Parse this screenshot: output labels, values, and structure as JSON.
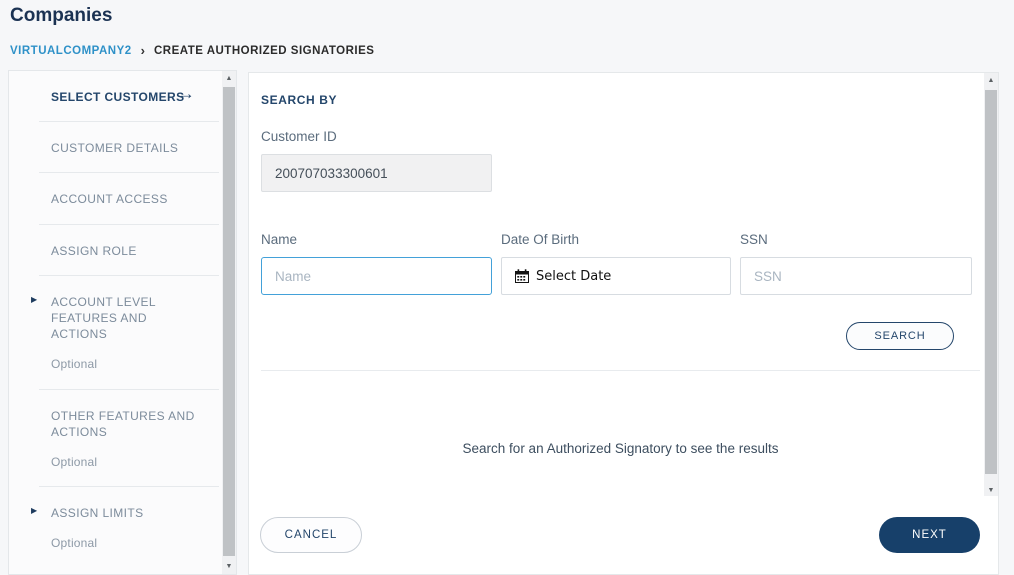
{
  "page": {
    "title": "Companies"
  },
  "breadcrumb": {
    "company": "VIRTUALCOMPANY2",
    "separator": "›",
    "current": "CREATE AUTHORIZED SIGNATORIES"
  },
  "icons": {
    "arrow_right": "→",
    "triangle_right": "▶",
    "scroll_up": "▲",
    "scroll_down": "▼"
  },
  "colors": {
    "accent_navy": "#24466b",
    "link_blue": "#2e91c8",
    "primary_button": "#17406a",
    "focus_border": "#43a1d9"
  },
  "sidebar": {
    "items": [
      {
        "label": "SELECT CUSTOMERS",
        "active": true
      },
      {
        "label": "CUSTOMER DETAILS"
      },
      {
        "label": "ACCOUNT ACCESS"
      },
      {
        "label": "ASSIGN ROLE"
      },
      {
        "label": "ACCOUNT LEVEL FEATURES AND ACTIONS",
        "sublabel": "Optional",
        "expandable": true
      },
      {
        "label": "OTHER FEATURES AND ACTIONS",
        "sublabel": "Optional"
      },
      {
        "label": "ASSIGN LIMITS",
        "sublabel": "Optional",
        "expandable": true
      }
    ]
  },
  "search_panel": {
    "heading": "SEARCH BY",
    "customer_id": {
      "label": "Customer ID",
      "value": "200707033300601"
    },
    "name": {
      "label": "Name",
      "placeholder": "Name",
      "value": ""
    },
    "dob": {
      "label": "Date Of Birth",
      "placeholder": "Select Date"
    },
    "ssn": {
      "label": "SSN",
      "placeholder": "SSN",
      "value": ""
    },
    "search_button": "SEARCH",
    "empty_message": "Search for an Authorized Signatory to see the results"
  },
  "footer": {
    "cancel": "CANCEL",
    "next": "NEXT"
  }
}
